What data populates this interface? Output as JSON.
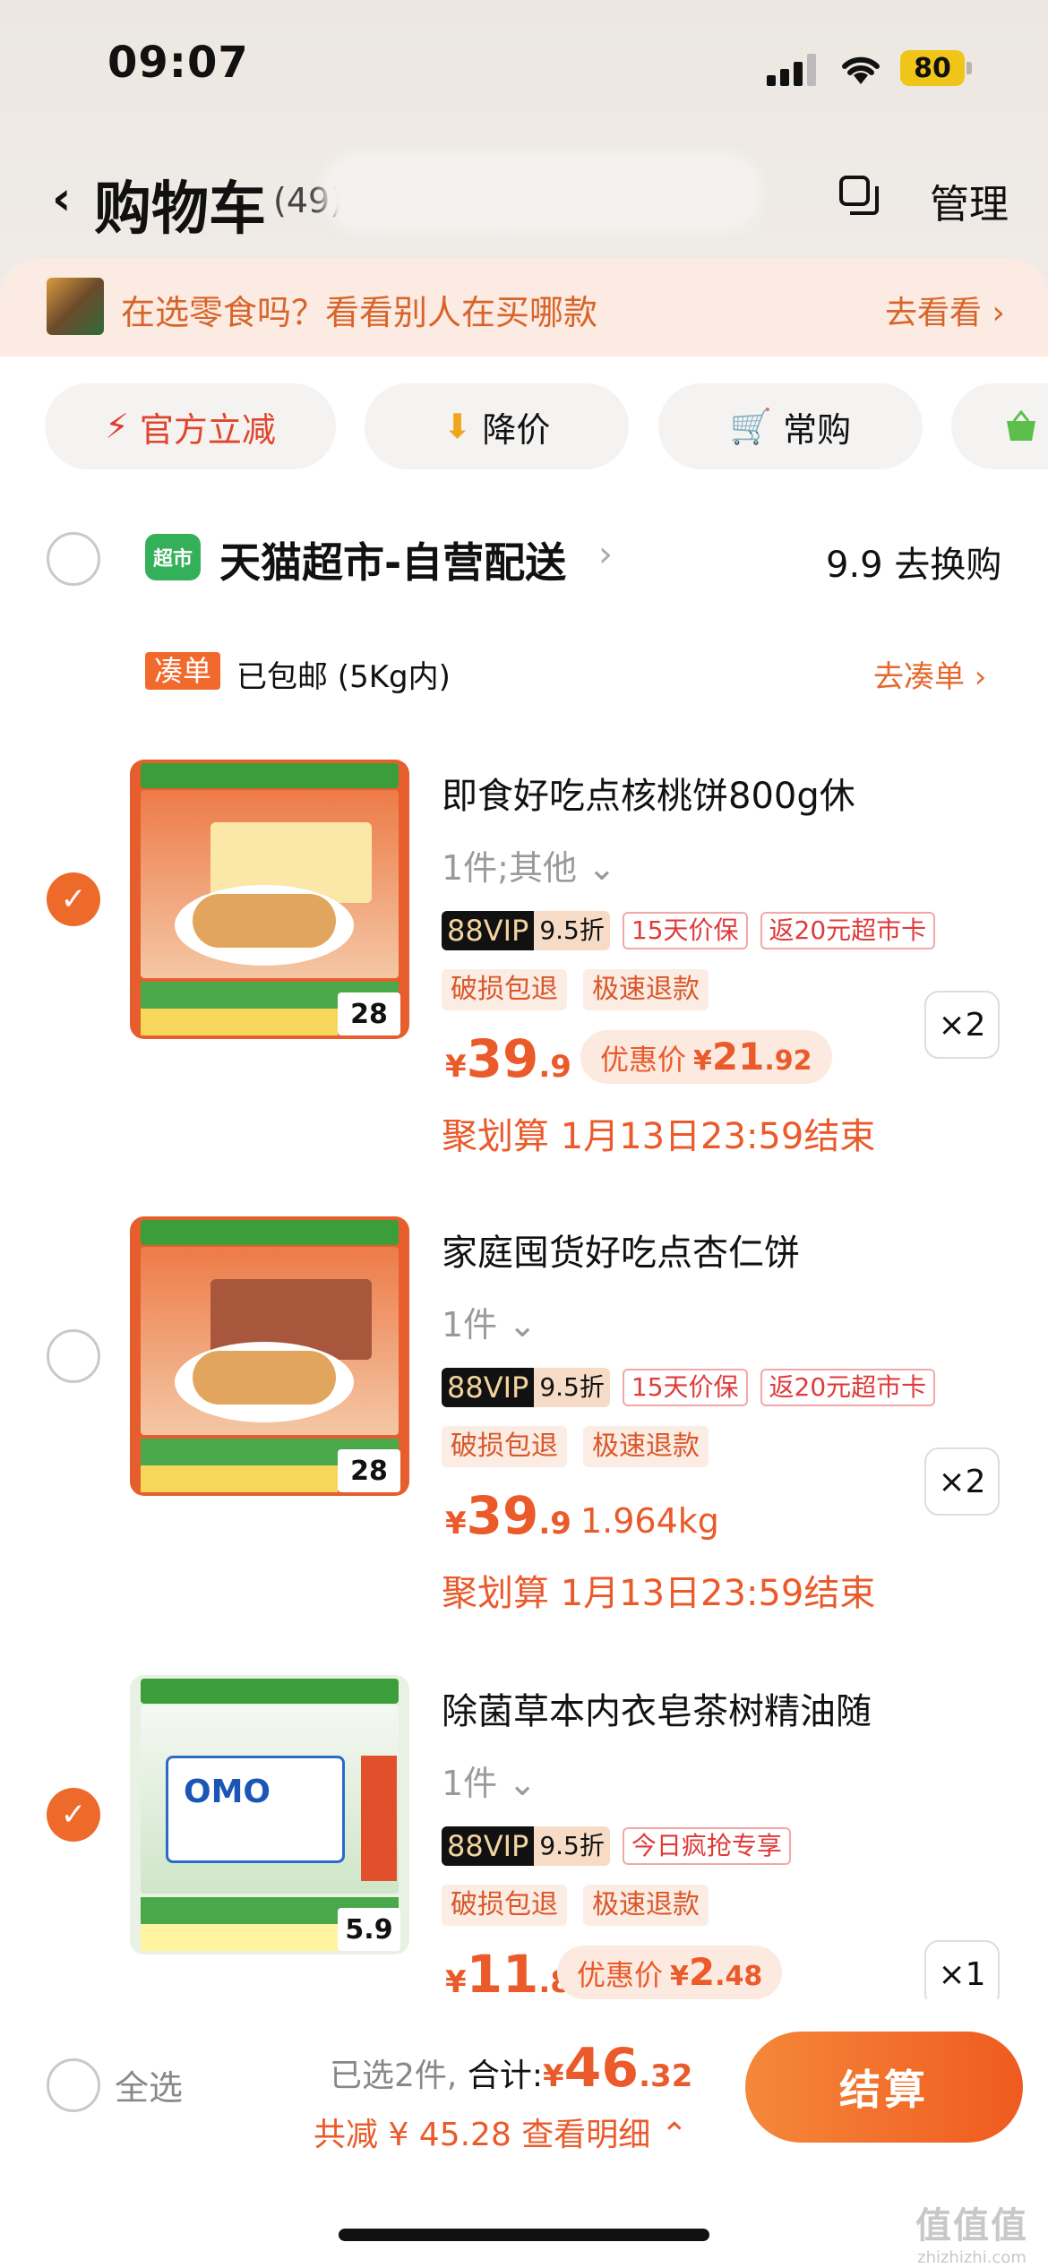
{
  "status": {
    "time": "09:07",
    "battery": "80"
  },
  "header": {
    "back": "‹",
    "title": "购物车",
    "count": "(49)",
    "manage": "管理"
  },
  "suggest": {
    "text": "在选零食吗？看看别人在买哪款",
    "link": "去看看 ›"
  },
  "chips": [
    {
      "icon": "⚡",
      "label": "官方立减"
    },
    {
      "icon": "⬇",
      "label": "降价"
    },
    {
      "icon": "🛒",
      "label": "常购"
    }
  ],
  "store": {
    "badge": "超市",
    "name": "天猫超市-自营配送",
    "arrow": "›",
    "promo": "9.9 去换购"
  },
  "combine": {
    "tag": "凑单",
    "text": "已包邮 (5Kg内)",
    "link": "去凑单 ›"
  },
  "items": [
    {
      "checked": true,
      "thumb_price": "28",
      "name": "即食好吃点核桃饼800g休",
      "spec": "1件;其他 ⌄",
      "vip": "88VIP",
      "vip_discount": "9.5折",
      "tag1": "15天价保",
      "tag2": "返20元超市卡",
      "feature1": "破损包退",
      "feature2": "极速退款",
      "price_int": "39",
      "price_dec": ".9",
      "promo_label": "优惠价",
      "promo_int": "21",
      "promo_dec": ".92",
      "deadline": "聚划算 1月13日23:59结束",
      "qty": "×2"
    },
    {
      "checked": false,
      "thumb_price": "28",
      "name": "家庭囤货好吃点杏仁饼",
      "spec": "1件 ⌄",
      "vip": "88VIP",
      "vip_discount": "9.5折",
      "tag1": "15天价保",
      "tag2": "返20元超市卡",
      "feature1": "破损包退",
      "feature2": "极速退款",
      "price_int": "39",
      "price_dec": ".9",
      "weight": "1.964kg",
      "deadline": "聚划算 1月13日23:59结束",
      "qty": "×2"
    },
    {
      "checked": true,
      "thumb_price": "5.9",
      "brand": "OMO",
      "name": "除菌草本内衣皂茶树精油随",
      "spec": "1件 ⌄",
      "vip": "88VIP",
      "vip_discount": "9.5折",
      "tag1": "今日疯抢专享",
      "feature1": "破损包退",
      "feature2": "极速退款",
      "price_int": "11",
      "price_dec": ".8",
      "promo_label": "优惠价",
      "promo_int": "2",
      "promo_dec": ".48",
      "qty": "×1"
    }
  ],
  "bottom": {
    "select_all": "全选",
    "selected": "已选2件,",
    "total_label": "合计:",
    "currency": "¥",
    "total_int": "46",
    "total_dec": ".32",
    "save": "共减 ¥ 45.28  查看明细 ⌃",
    "checkout": "结算"
  },
  "watermark": {
    "main": "值值值",
    "sub": "zhizhizhi.com"
  },
  "colors": {
    "accent": "#ea5a2a",
    "checkout": "#ef5a1f",
    "vip_bg": "#111111"
  }
}
